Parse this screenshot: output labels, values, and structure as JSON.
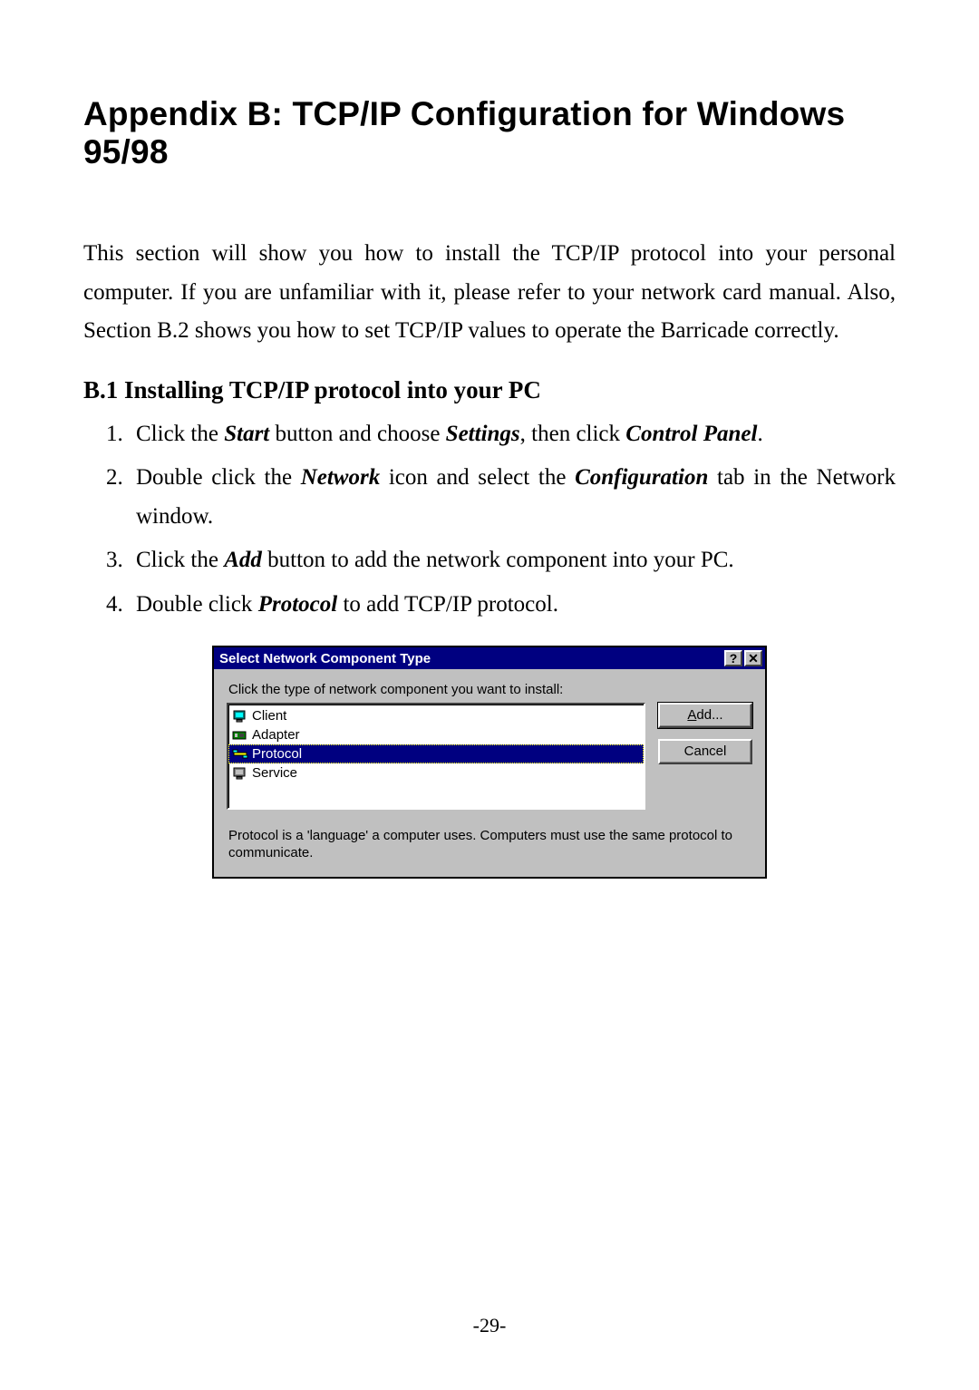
{
  "title": "Appendix B:  TCP/IP Configuration for Windows 95/98",
  "intro": "This section will show you how to install the TCP/IP protocol into your personal computer. If you are unfamiliar with it, please refer to your network card manual. Also, Section B.2 shows you how to set TCP/IP values to operate the Barricade correctly.",
  "subhead": "B.1 Installing TCP/IP protocol into your PC",
  "steps": {
    "s1": {
      "t1": "Click the ",
      "b1": "Start",
      "t2": " button and choose ",
      "b2": "Settings",
      "t3": ", then click ",
      "b3": "Control Panel",
      "t4": "."
    },
    "s2": {
      "t1": "Double click the ",
      "b1": "Network",
      "t2": " icon and select the ",
      "b2": "Configuration",
      "t3": " tab in the Network window."
    },
    "s3": {
      "t1": "Click the ",
      "b1": "Add",
      "t2": " button to add the network component into your PC."
    },
    "s4": {
      "t1": "Double click ",
      "b1": "Protocol",
      "t2": " to add TCP/IP protocol."
    }
  },
  "dialog": {
    "title": "Select Network Component Type",
    "help_glyph": "?",
    "close_glyph": "✕",
    "instruction": "Click the type of network component you want to install:",
    "items": {
      "client": {
        "label": "Client",
        "selected": false
      },
      "adapter": {
        "label": "Adapter",
        "selected": false
      },
      "protocol": {
        "label": "Protocol",
        "selected": true
      },
      "service": {
        "label": "Service",
        "selected": false
      }
    },
    "buttons": {
      "add_prefix": "A",
      "add_rest": "dd...",
      "cancel": "Cancel"
    },
    "description": "Protocol is a 'language' a computer uses. Computers must use the same protocol to communicate."
  },
  "page_number": "-29-"
}
